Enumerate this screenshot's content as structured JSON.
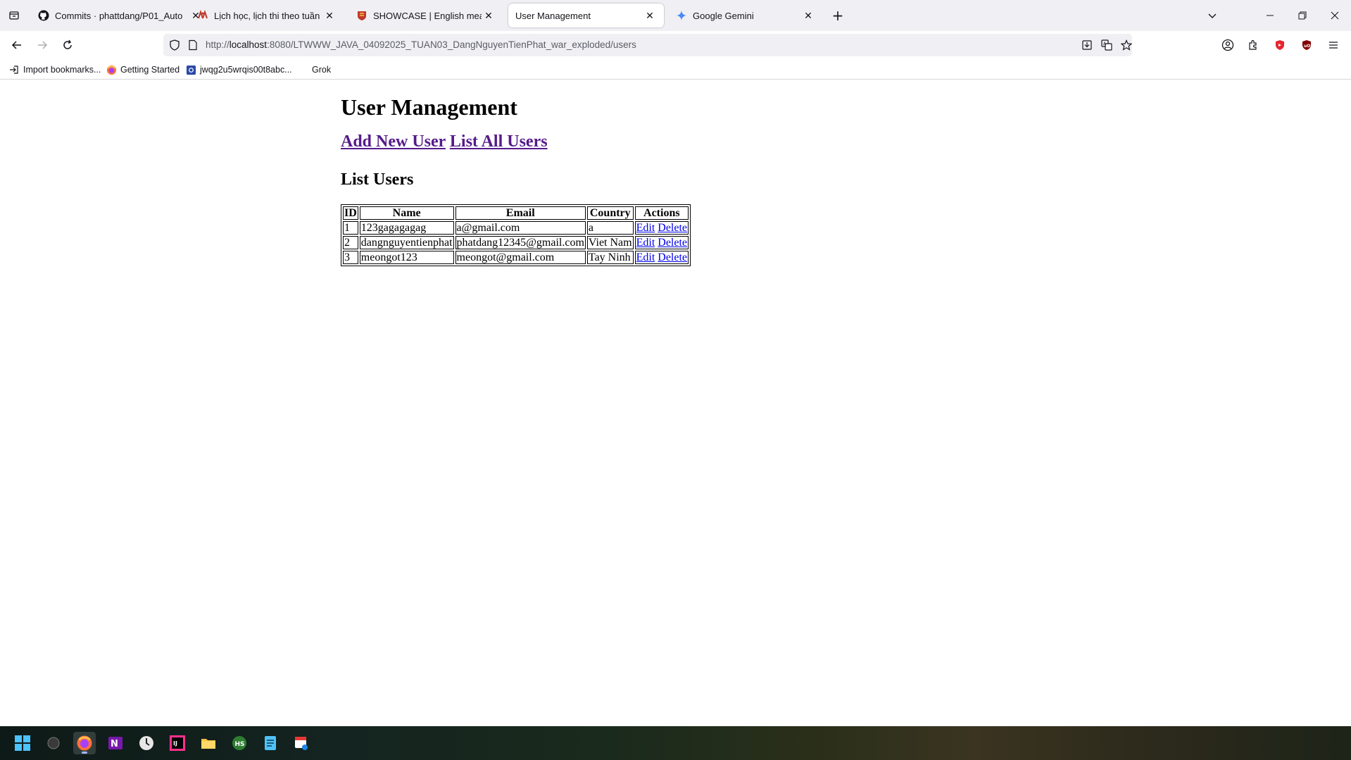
{
  "browser": {
    "tabs": [
      {
        "title": "Commits · phattdang/P01_Auto",
        "icon": "github-icon"
      },
      {
        "title": "Lịch học, lịch thi theo tuần",
        "icon": "school-logo-icon"
      },
      {
        "title": "SHOWCASE | English meaning -",
        "icon": "cambridge-icon"
      },
      {
        "title": "User Management",
        "icon": "blank-page-icon"
      },
      {
        "title": "Google Gemini",
        "icon": "gemini-icon"
      }
    ],
    "active_tab_index": 3,
    "url": {
      "prefix": "http://",
      "host": "localhost",
      "rest": ":8080/LTWWW_JAVA_04092025_TUAN03_DangNguyenTienPhat_war_exploded/users"
    },
    "bookmarks": [
      {
        "label": "Import bookmarks...",
        "icon": "import-icon"
      },
      {
        "label": "Getting Started",
        "icon": "firefox-icon"
      },
      {
        "label": "jwqg2u5wrqis00t8abc...",
        "icon": "site-icon"
      },
      {
        "label": "Grok",
        "icon": "grok-icon"
      }
    ]
  },
  "page": {
    "title": "User Management",
    "links": {
      "add_new": "Add New User",
      "list_all": "List All Users"
    },
    "subtitle": "List Users",
    "table": {
      "headers": [
        "ID",
        "Name",
        "Email",
        "Country",
        "Actions"
      ],
      "rows": [
        {
          "id": "1",
          "name": "123gagagagag",
          "email": "a@gmail.com",
          "country": "a",
          "edit": "Edit",
          "delete": "Delete"
        },
        {
          "id": "2",
          "name": "dangnguyentienphat",
          "email": "phatdang12345@gmail.com",
          "country": "Viet Nam",
          "edit": "Edit",
          "delete": "Delete"
        },
        {
          "id": "3",
          "name": "meongot123",
          "email": "meongot@gmail.com",
          "country": "Tay Ninh",
          "edit": "Edit",
          "delete": "Delete"
        }
      ]
    }
  },
  "taskbar": {
    "apps": [
      "windows-start-icon",
      "search-icon",
      "firefox-icon",
      "onenote-icon",
      "clock-app-icon",
      "intellij-icon",
      "file-explorer-icon",
      "hs-app-icon",
      "notepad-icon",
      "snipping-tool-icon"
    ],
    "active_app": "firefox-icon"
  },
  "colors": {
    "visited_link": "#551a8b",
    "link": "#0000ee",
    "tabstrip_bg": "#f0f0f4",
    "urlbar_bg": "#f0f0f4"
  }
}
